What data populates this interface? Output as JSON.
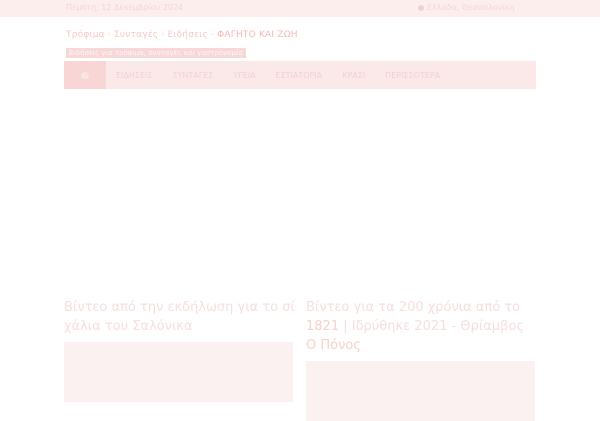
{
  "topbar": {
    "left_text": "Πέμπτη, 12 Δεκεμβρίου 2024",
    "right_text": "Ελλάδα, Θεσσαλονίκη"
  },
  "brand": {
    "name_main": "Τρόφιμα · Συνταγές · Ειδήσεις ·",
    "name_accent": "ΦΑΓΗΤΟ ΚΑΙ ΖΩΗ",
    "tagline": "Ειδήσεις για τρόφιμα, συνταγές και γαστρονομία"
  },
  "nav": {
    "items": [
      "ΕΙΔΗΣΕΙΣ",
      "ΣΥΝΤΑΓΕΣ",
      "ΥΓΕΙΑ",
      "ΕΣΤΙΑΤΟΡΙΑ",
      "ΚΡΑΣΙ",
      "ΠΕΡΙΣΣΟΤΕΡΑ"
    ]
  },
  "posts": [
    {
      "title": "Βίντεο από την εκδήλωση για το σί χάλια του Σαλόνικα"
    },
    {
      "title_main": "Βίντεο για τα 200 χρόνια από το ",
      "title_hl": "1821",
      "title_rest": " | Ιδρύθηκε 2021 - Θρίαμβος ",
      "title_tail": "Ο Πόνος"
    }
  ]
}
